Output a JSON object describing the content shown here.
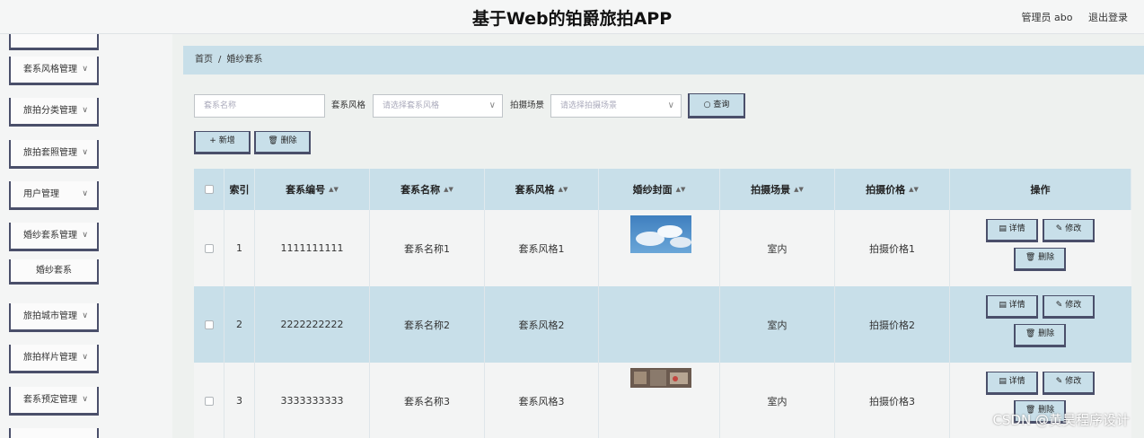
{
  "header": {
    "title": "基于Web的铂爵旅拍APP",
    "user": "管理员 abo",
    "logout": "退出登录"
  },
  "sidebar": {
    "items": [
      {
        "label": ""
      },
      {
        "label": "套系风格管理"
      },
      {
        "label": "旅拍分类管理"
      },
      {
        "label": "旅拍套照管理"
      },
      {
        "label": "用户管理"
      },
      {
        "label": "婚纱套系管理"
      },
      {
        "label": "旅拍城市管理"
      },
      {
        "label": "旅拍样片管理"
      },
      {
        "label": "套系预定管理"
      }
    ],
    "sub_item": "婚纱套系",
    "chevron": "∨"
  },
  "breadcrumb": {
    "home": "首页",
    "sep": "/",
    "current": "婚纱套系"
  },
  "search": {
    "name_placeholder": "套系名称",
    "style_label": "套系风格",
    "style_placeholder": "请选择套系风格",
    "scene_label": "拍摄场景",
    "scene_placeholder": "请选择拍摄场景",
    "query_button": "○ 查询"
  },
  "actions": {
    "add": "+ 新增",
    "delete": "🗑 删除"
  },
  "table": {
    "headers": [
      "索引",
      "套系编号",
      "套系名称",
      "套系风格",
      "婚纱封面",
      "拍摄场景",
      "拍摄价格",
      "操作"
    ],
    "rows": [
      {
        "index": "1",
        "code": "1111111111",
        "name": "套系名称1",
        "style": "套系风格1",
        "cover": "sky",
        "scene": "室内",
        "price": "拍摄价格1"
      },
      {
        "index": "2",
        "code": "2222222222",
        "name": "套系名称2",
        "style": "套系风格2",
        "cover": "",
        "scene": "室内",
        "price": "拍摄价格2"
      },
      {
        "index": "3",
        "code": "3333333333",
        "name": "套系名称3",
        "style": "套系风格3",
        "cover": "street",
        "scene": "室内",
        "price": "拍摄价格3"
      }
    ],
    "op_detail": "▤ 详情",
    "op_edit": "✎ 修改",
    "op_delete": "🗑 删除"
  },
  "watermark": "CSDN @黄昊程序设计",
  "colors": {
    "accent": "#c8dfe9",
    "border": "#4a4f6a"
  }
}
